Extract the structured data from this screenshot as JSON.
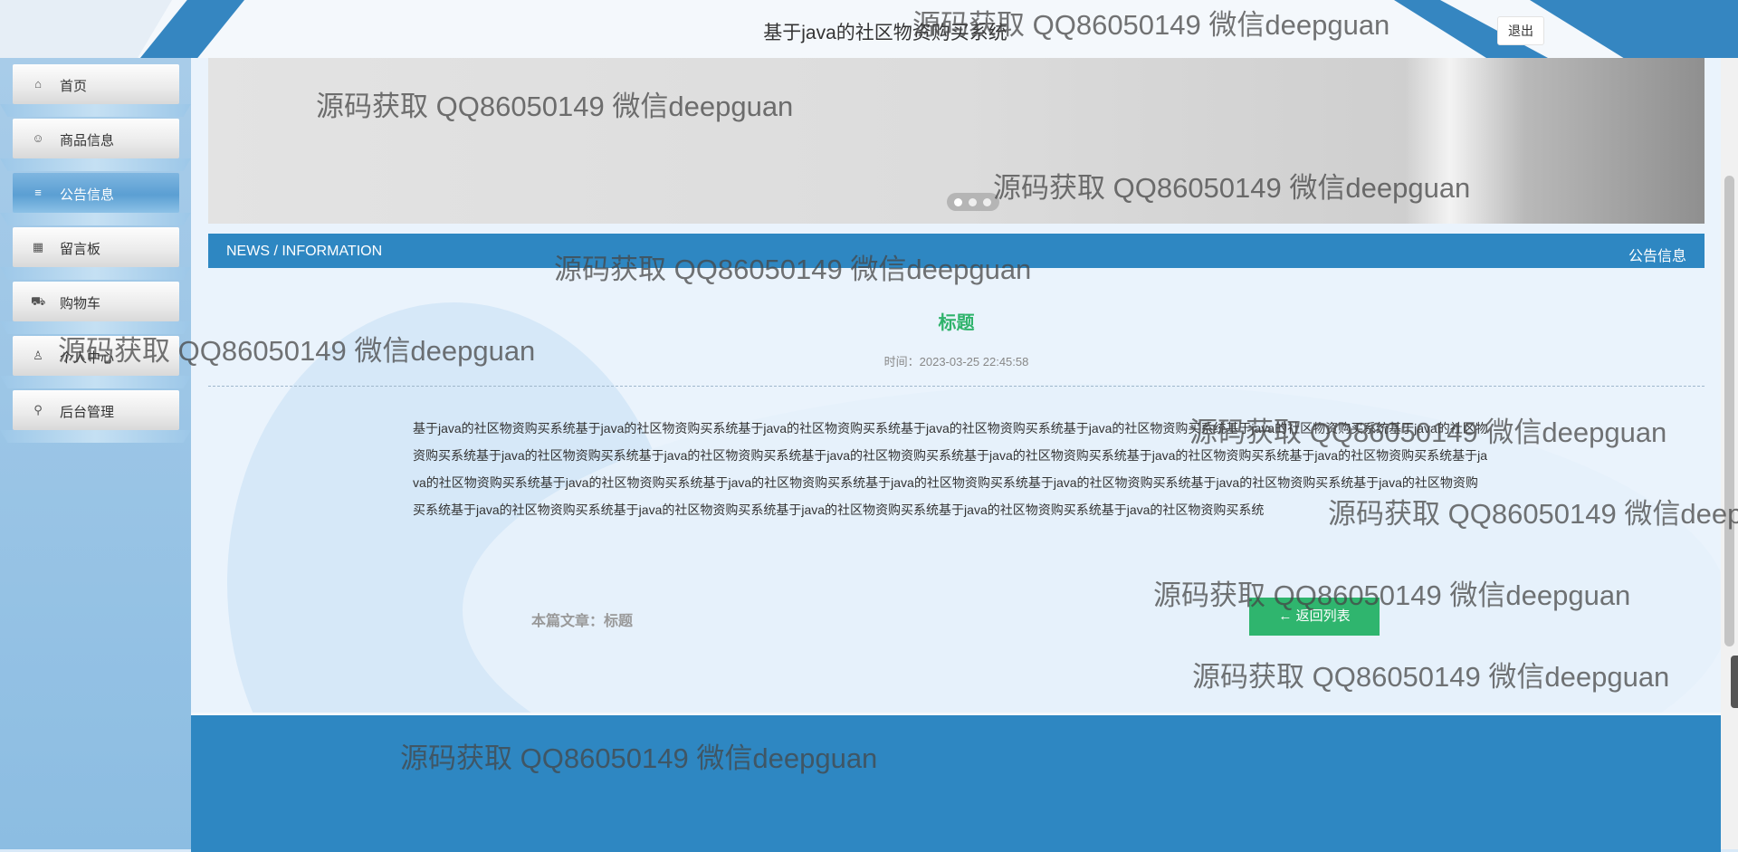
{
  "header": {
    "title": "基于java的社区物资购买系统",
    "logout_label": "退出"
  },
  "sidebar": {
    "items": [
      {
        "label": "首页",
        "icon": "home-icon",
        "active": false
      },
      {
        "label": "商品信息",
        "icon": "smile-icon",
        "active": false
      },
      {
        "label": "公告信息",
        "icon": "sliders-icon",
        "active": true
      },
      {
        "label": "留言板",
        "icon": "calendar-icon",
        "active": false
      },
      {
        "label": "购物车",
        "icon": "cart-icon",
        "active": false
      },
      {
        "label": "个人中心",
        "icon": "user-icon",
        "active": false
      },
      {
        "label": "后台管理",
        "icon": "link-icon",
        "active": false
      }
    ]
  },
  "banner": {
    "slides_count": 3,
    "active_slide": 1
  },
  "news_bar": {
    "left": "NEWS / INFORMATION",
    "right": "公告信息"
  },
  "article": {
    "title": "标题",
    "time": "时间：2023-03-25 22:45:58",
    "body": "基于java的社区物资购买系统基于java的社区物资购买系统基于java的社区物资购买系统基于java的社区物资购买系统基于java的社区物资购买系统基于java的社区物资购买系统基于java的社区物资购买系统基于java的社区物资购买系统基于java的社区物资购买系统基于java的社区物资购买系统基于java的社区物资购买系统基于java的社区物资购买系统基于java的社区物资购买系统基于java的社区物资购买系统基于java的社区物资购买系统基于java的社区物资购买系统基于java的社区物资购买系统基于java的社区物资购买系统基于java的社区物资购买系统基于java的社区物资购买系统基于java的社区物资购买系统基于java的社区物资购买系统基于java的社区物资购买系统基于java的社区物资购买系统基于java的社区物资购买系统",
    "this_article": "本篇文章：标题",
    "back_label": "返回列表"
  },
  "watermark": "源码获取 QQ86050149 微信deepguan",
  "colors": {
    "primary": "#2e87c2",
    "accent_green": "#2fb36b",
    "sidebar_bg": "#9cc7e8"
  }
}
